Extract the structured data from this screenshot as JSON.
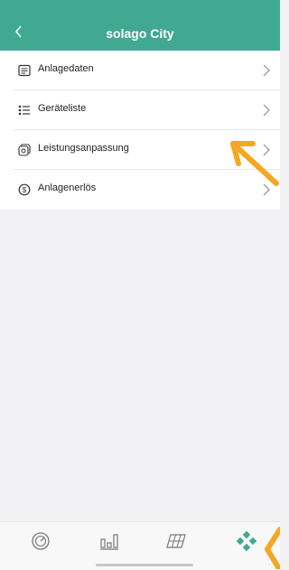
{
  "header": {
    "title": "solago City",
    "back_icon": "chevron-left-icon",
    "color": "#41a892"
  },
  "menu": {
    "items": [
      {
        "label": "Anlagedaten",
        "icon": "document-icon"
      },
      {
        "label": "Geräteliste",
        "icon": "list-icon"
      },
      {
        "label": "Leistungsanpassung",
        "icon": "power-adjust-icon"
      },
      {
        "label": "Anlagenerlös",
        "icon": "revenue-icon"
      }
    ]
  },
  "tabbar": {
    "tabs": [
      {
        "icon": "gauge-icon",
        "active": false
      },
      {
        "icon": "bar-chart-icon",
        "active": false
      },
      {
        "icon": "solar-panel-icon",
        "active": false
      },
      {
        "icon": "diamond-grid-icon",
        "active": true
      }
    ],
    "active_color": "#41a892"
  },
  "annotation_color": "#f5a623"
}
